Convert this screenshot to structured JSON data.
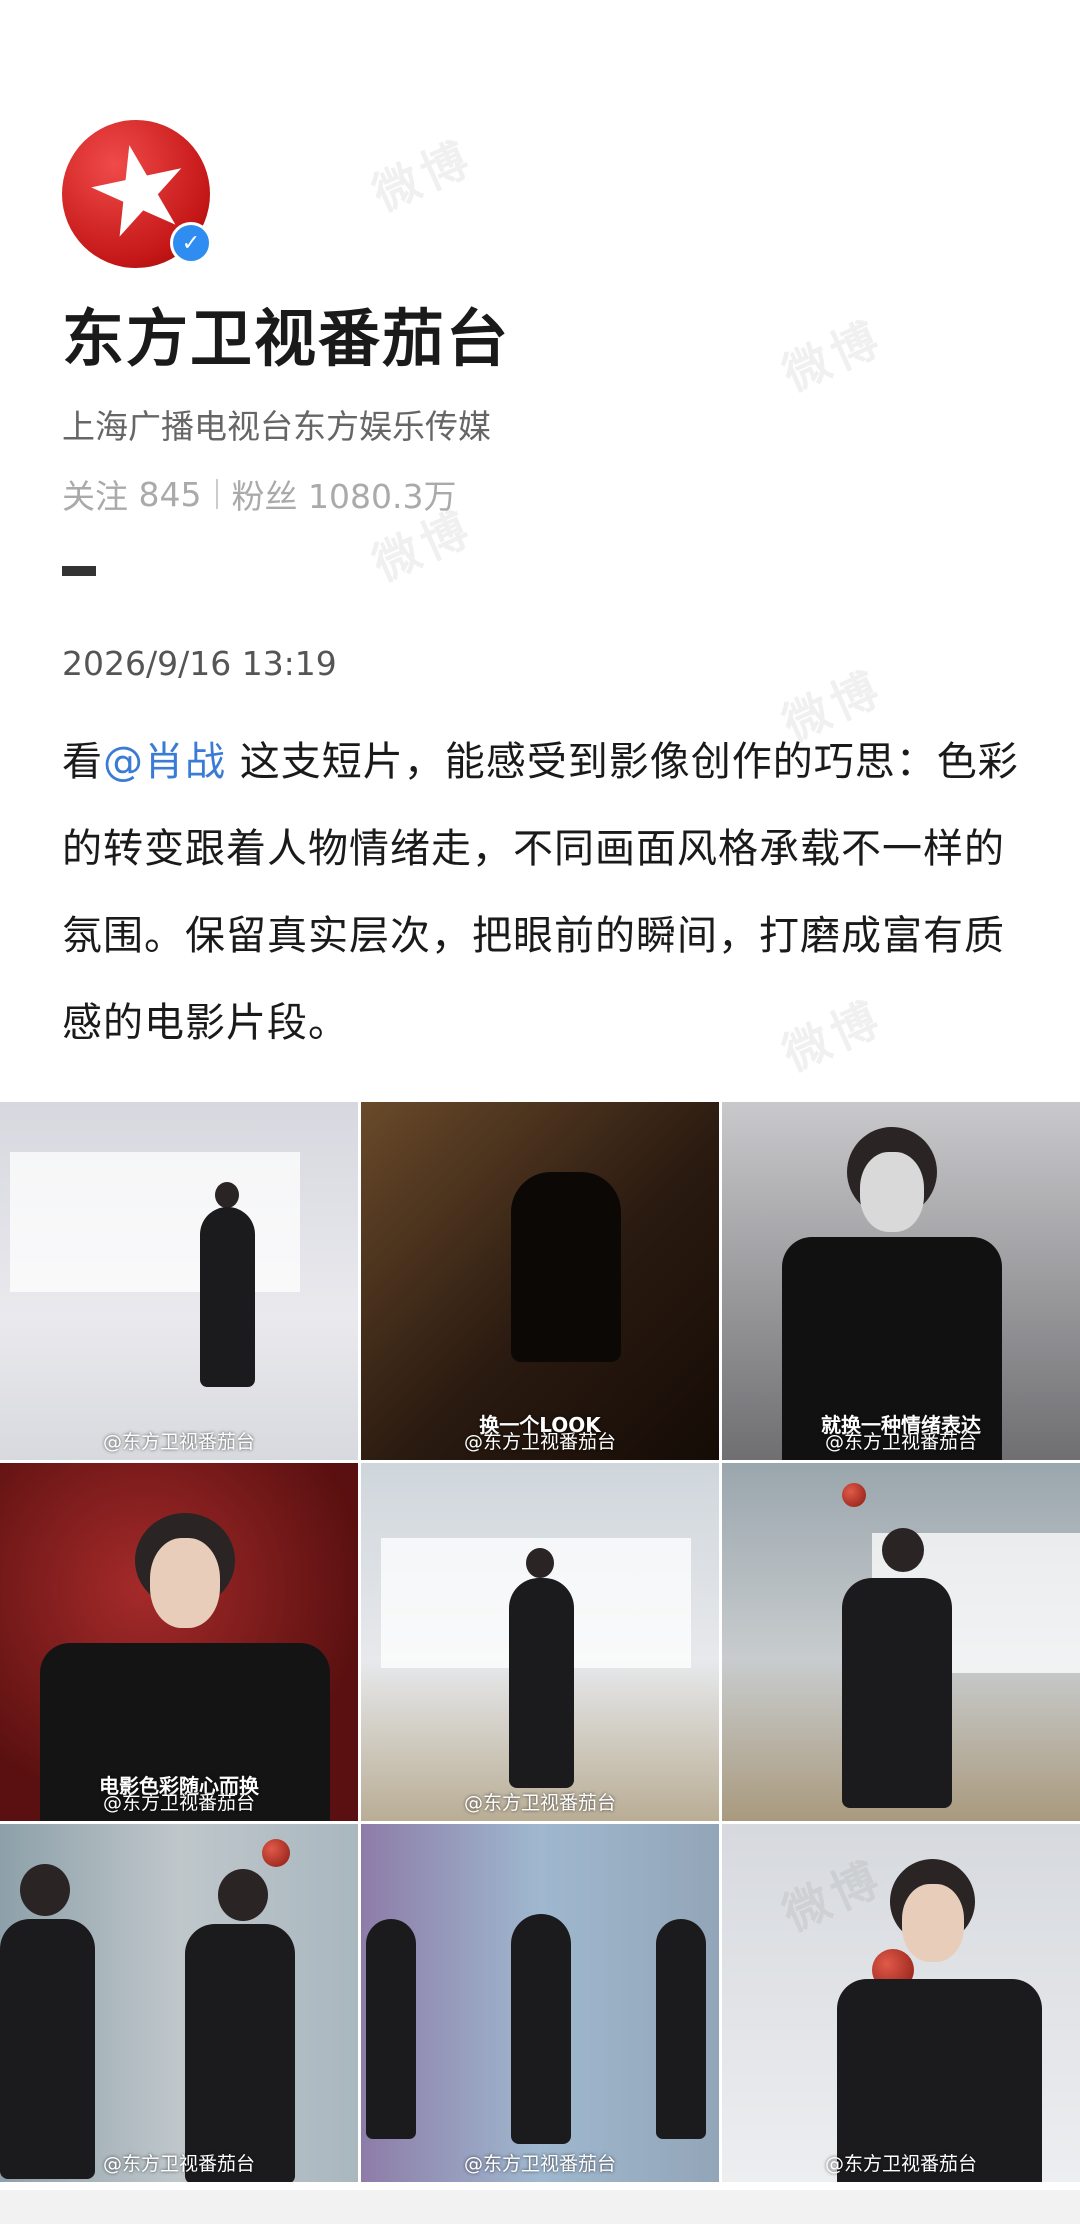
{
  "profile": {
    "name": "东方卫视番茄台",
    "description": "上海广播电视台东方娱乐传媒",
    "following_label": "关注",
    "following_count": "845",
    "followers_label": "粉丝",
    "followers_count": "1080.3万"
  },
  "post": {
    "timestamp": "2026/9/16 13:19",
    "text_prefix": "看",
    "mention": "@肖战",
    "text_body": " 这支短片，能感受到影像创作的巧思：色彩的转变跟着人物情绪走，不同画面风格承载不一样的氛围。保留真实层次，把眼前的瞬间，打磨成富有质感的电影片段。"
  },
  "images": [
    {
      "watermark": "@东方卫视番茄台",
      "caption": ""
    },
    {
      "watermark": "@东方卫视番茄台",
      "caption": "换一个LOOK"
    },
    {
      "watermark": "@东方卫视番茄台",
      "caption": "就换一种情绪表达"
    },
    {
      "watermark": "@东方卫视番茄台",
      "caption": "电影色彩随心而换"
    },
    {
      "watermark": "@东方卫视番茄台",
      "caption": ""
    },
    {
      "watermark": "",
      "caption": ""
    },
    {
      "watermark": "@东方卫视番茄台",
      "caption": ""
    },
    {
      "watermark": "@东方卫视番茄台",
      "caption": ""
    },
    {
      "watermark": "@东方卫视番茄台",
      "caption": ""
    }
  ],
  "background_watermark": "微博",
  "colors": {
    "mention": "#3a7bd5",
    "avatar": "#c41616",
    "verify": "#2f8cf0"
  }
}
